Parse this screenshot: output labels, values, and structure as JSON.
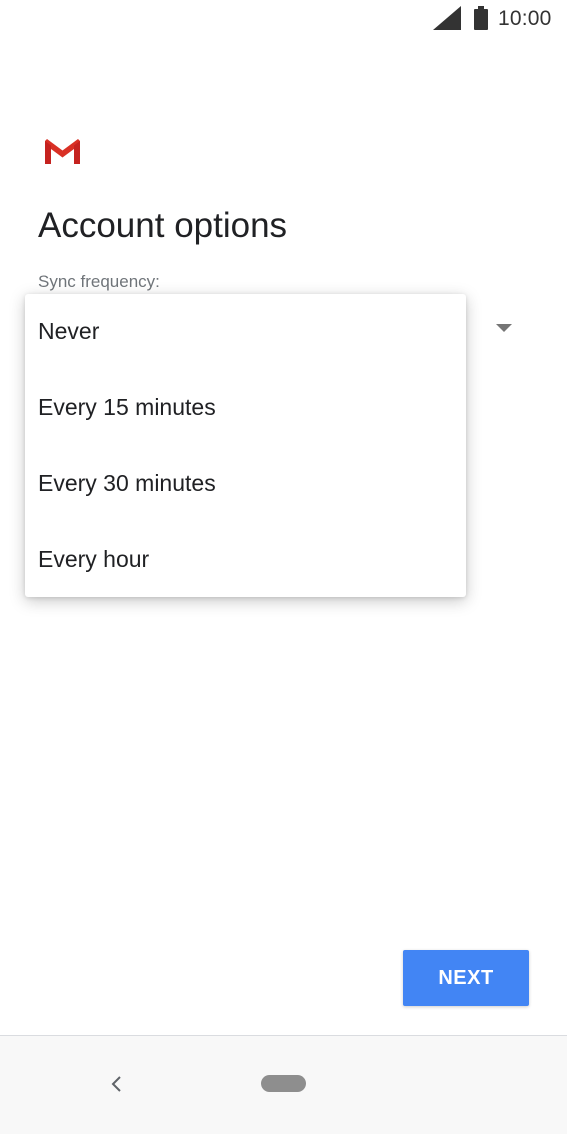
{
  "status_bar": {
    "time": "10:00",
    "signal_icon": "cellular-signal-icon",
    "battery_icon": "battery-icon"
  },
  "app": {
    "logo_icon": "gmail-icon",
    "title": "Account options"
  },
  "sync": {
    "label": "Sync frequency:",
    "options": [
      "Never",
      "Every 15 minutes",
      "Every 30 minutes",
      "Every hour"
    ]
  },
  "actions": {
    "next_label": "NEXT"
  },
  "navigation": {
    "back_icon": "back-chevron-icon",
    "home_icon": "home-pill-icon"
  },
  "colors": {
    "accent": "#4285f4",
    "gmail_red": "#d93025",
    "text_primary": "#202124",
    "text_secondary": "#70757a"
  }
}
